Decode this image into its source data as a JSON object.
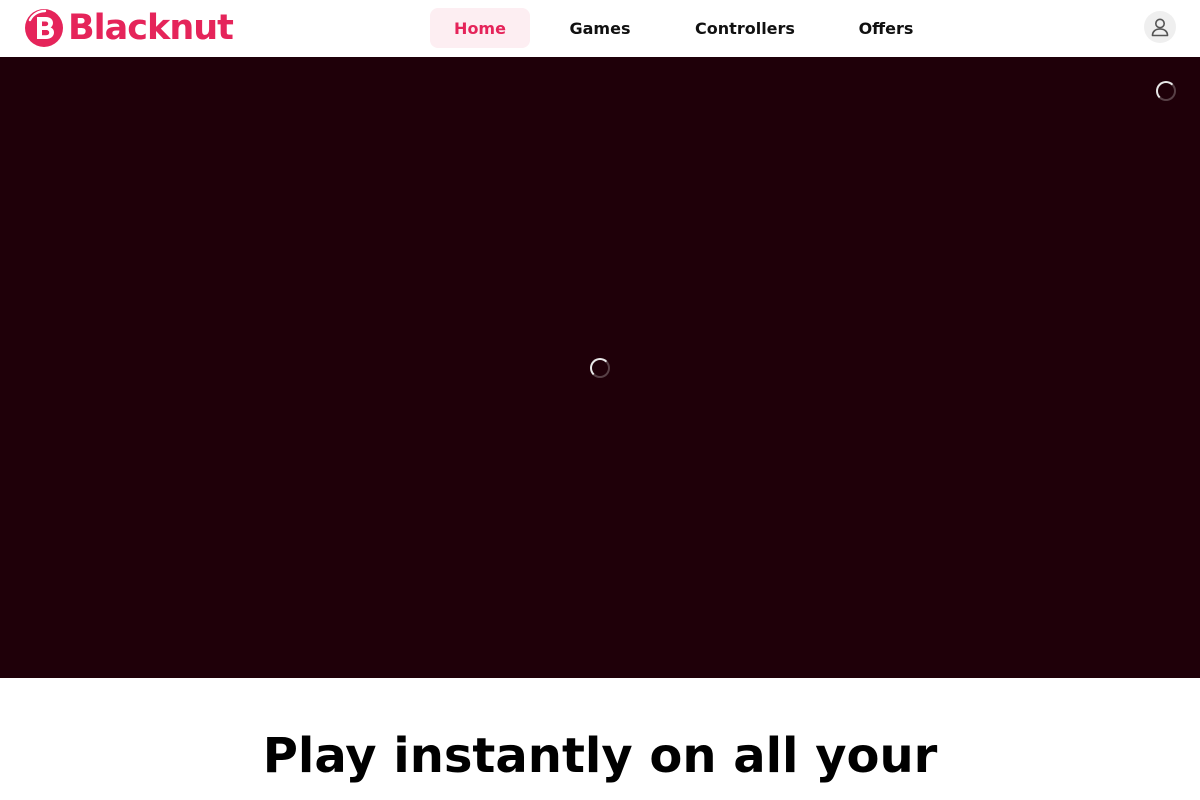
{
  "brand": {
    "name": "Blacknut",
    "color": "#e5245a",
    "logo_icon": "blacknut-logo-icon"
  },
  "nav": {
    "items": [
      {
        "label": "Home",
        "active": true
      },
      {
        "label": "Games",
        "active": false
      },
      {
        "label": "Controllers",
        "active": false
      },
      {
        "label": "Offers",
        "active": false
      }
    ]
  },
  "account": {
    "icon": "user-icon"
  },
  "hero": {
    "background": "#1f0009",
    "state": "loading",
    "spinner_icons": [
      "loading-spinner-icon",
      "loading-spinner-icon"
    ]
  },
  "main": {
    "headline": "Play instantly on all your"
  }
}
